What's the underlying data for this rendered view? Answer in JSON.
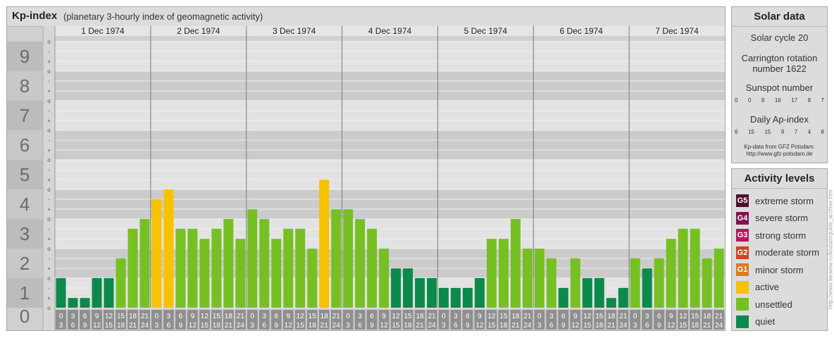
{
  "header": {
    "title": "Kp-index",
    "subtitle": "(planetary 3-hourly index of geomagnetic activity)"
  },
  "solar": {
    "title": "Solar data",
    "cycle": "Solar cycle 20",
    "carrington_1": "Carrington rotation",
    "carrington_2": "number 1622",
    "sunspot_title": "Sunspot number",
    "sunspot_values": [
      "0",
      "0",
      "9",
      "16",
      "17",
      "8",
      "7"
    ],
    "ap_title": "Daily Ap-index",
    "ap_values": [
      "6",
      "15",
      "15",
      "9",
      "7",
      "4",
      "8"
    ],
    "credit_1": "Kp-data from GFZ Potsdam:",
    "credit_2": "http://www.gfz-potsdam.de"
  },
  "levels": {
    "title": "Activity levels",
    "items": [
      {
        "badge": "G5",
        "label": "extreme storm",
        "color": "#4d0f2c"
      },
      {
        "badge": "G4",
        "label": "severe storm",
        "color": "#7d1450"
      },
      {
        "badge": "G3",
        "label": "strong storm",
        "color": "#c0115e"
      },
      {
        "badge": "G2",
        "label": "moderate storm",
        "color": "#d94024"
      },
      {
        "badge": "G1",
        "label": "minor storm",
        "color": "#e07a1a"
      },
      {
        "badge": "",
        "label": "active",
        "color": "#f7c200"
      },
      {
        "badge": "",
        "label": "unsettled",
        "color": "#77c023"
      },
      {
        "badge": "",
        "label": "quiet",
        "color": "#0b8a4c"
      }
    ]
  },
  "watermark": "http://www.tieuwse.ru/kodam/guide_archive.htm",
  "chart_data": {
    "type": "bar",
    "title": "Kp-index",
    "ylim": [
      0,
      9
    ],
    "y_ticks": [
      "0",
      "1",
      "2",
      "3",
      "4",
      "5",
      "6",
      "7",
      "8",
      "9"
    ],
    "minor_ticks": [
      "+",
      "o",
      "-"
    ],
    "days": [
      "1 Dec 1974",
      "2 Dec 1974",
      "3 Dec 1974",
      "4 Dec 1974",
      "5 Dec 1974",
      "6 Dec 1974",
      "7 Dec 1974"
    ],
    "slot_labels": [
      [
        "0",
        "3"
      ],
      [
        "3",
        "6"
      ],
      [
        "6",
        "9"
      ],
      [
        "9",
        "12"
      ],
      [
        "12",
        "15"
      ],
      [
        "15",
        "18"
      ],
      [
        "18",
        "21"
      ],
      [
        "21",
        "24"
      ]
    ],
    "colors": {
      "quiet": "#0b8a4c",
      "unsettled": "#77c023",
      "active": "#f7c200"
    },
    "series": [
      {
        "day": "1 Dec 1974",
        "values": [
          1.0,
          0.33,
          0.33,
          1.0,
          1.0,
          1.67,
          2.67,
          3.0
        ]
      },
      {
        "day": "2 Dec 1974",
        "values": [
          3.67,
          4.0,
          2.67,
          2.67,
          2.33,
          2.67,
          3.0,
          2.33
        ]
      },
      {
        "day": "3 Dec 1974",
        "values": [
          3.33,
          3.0,
          2.33,
          2.67,
          2.67,
          2.0,
          4.33,
          3.33
        ]
      },
      {
        "day": "4 Dec 1974",
        "values": [
          3.33,
          3.0,
          2.67,
          2.0,
          1.33,
          1.33,
          1.0,
          1.0
        ]
      },
      {
        "day": "5 Dec 1974",
        "values": [
          0.67,
          0.67,
          0.67,
          1.0,
          2.33,
          2.33,
          3.0,
          2.0
        ]
      },
      {
        "day": "6 Dec 1974",
        "values": [
          2.0,
          1.67,
          0.67,
          1.67,
          1.0,
          1.0,
          0.33,
          0.67
        ]
      },
      {
        "day": "7 Dec 1974",
        "values": [
          1.67,
          1.33,
          1.67,
          2.33,
          2.67,
          2.67,
          1.67,
          2.0
        ]
      }
    ]
  }
}
